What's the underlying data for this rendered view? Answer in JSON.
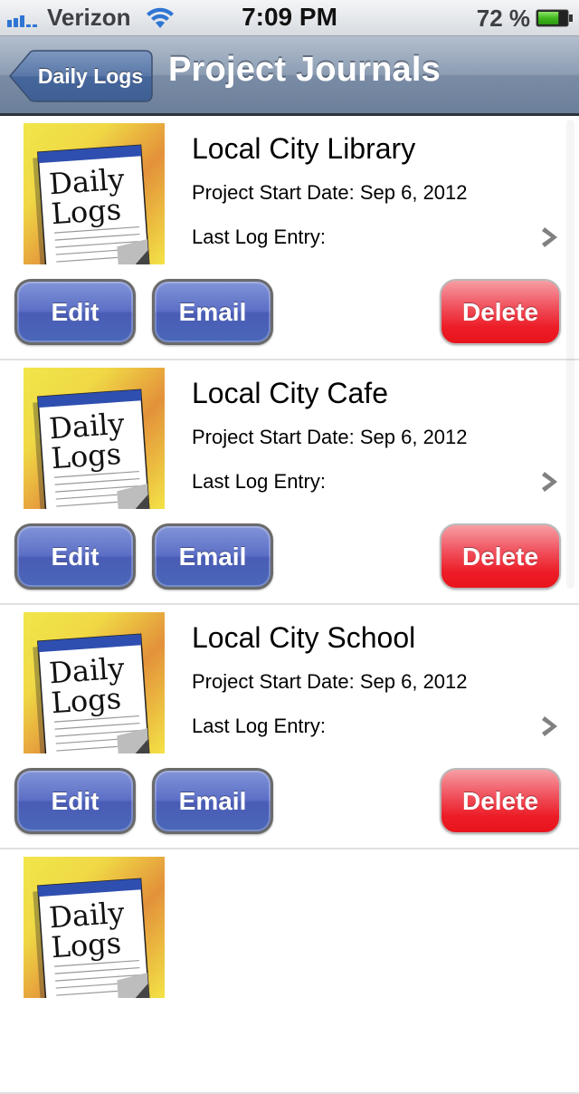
{
  "status_bar": {
    "carrier": "Verizon",
    "signal_icon": "cellular-signal-icon",
    "wifi_icon": "wifi-icon",
    "time": "7:09 PM",
    "battery_percent": "72 %",
    "battery_level": 0.72,
    "battery_icon": "battery-icon"
  },
  "nav": {
    "back_label": "Daily Logs",
    "title": "Project Journals"
  },
  "colors": {
    "nav_bar": "#8c9db3",
    "button_blue": "#5c6fc6",
    "button_red": "#ec1c26"
  },
  "projects": [
    {
      "name": "Local City Library",
      "start_date": "Project Start Date: Sep 6, 2012",
      "last_log": "Last Log Entry:",
      "icon_text_1": "Daily",
      "icon_text_2": "Logs",
      "edit_label": "Edit",
      "email_label": "Email",
      "delete_label": "Delete"
    },
    {
      "name": "Local City Cafe",
      "start_date": "Project Start Date: Sep 6, 2012",
      "last_log": "Last Log Entry:",
      "icon_text_1": "Daily",
      "icon_text_2": "Logs",
      "edit_label": "Edit",
      "email_label": "Email",
      "delete_label": "Delete"
    },
    {
      "name": "Local City School",
      "start_date": "Project Start Date: Sep 6, 2012",
      "last_log": "Last Log Entry:",
      "icon_text_1": "Daily",
      "icon_text_2": "Logs",
      "edit_label": "Edit",
      "email_label": "Email",
      "delete_label": "Delete"
    },
    {
      "name": "",
      "start_date": "",
      "last_log": "",
      "icon_text_1": "Daily",
      "icon_text_2": "Logs",
      "edit_label": "",
      "email_label": "",
      "delete_label": ""
    }
  ]
}
